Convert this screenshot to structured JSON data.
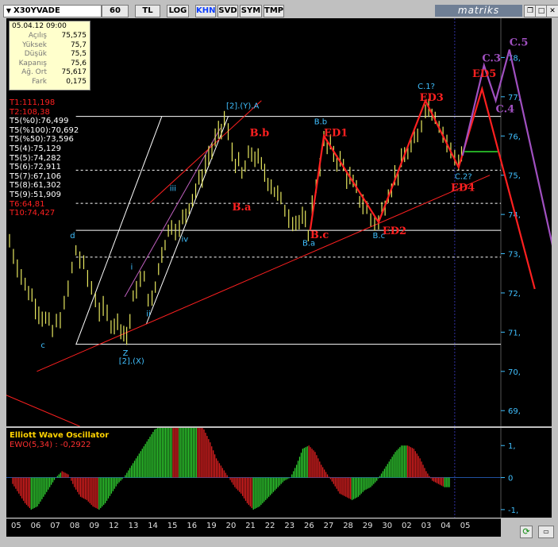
{
  "toolbar": {
    "symbol": "X30YVADE",
    "buttons": [
      {
        "label": "60",
        "active": false
      },
      {
        "label": "TL",
        "active": false
      },
      {
        "label": "LOG",
        "active": false
      },
      {
        "label": "KHN",
        "active": true
      },
      {
        "label": "SVD",
        "active": false
      },
      {
        "label": "SYM",
        "active": false
      },
      {
        "label": "TMP",
        "active": false
      }
    ],
    "brand": "matriks",
    "window_buttons": {
      "restore": "❐",
      "max": "□",
      "close": "✕"
    }
  },
  "info_box": {
    "datetime": "05.04.12 09:00",
    "rows": [
      {
        "label": "Açılış",
        "value": "75,575"
      },
      {
        "label": "Yüksek",
        "value": "75,7"
      },
      {
        "label": "Düşük",
        "value": "75,5"
      },
      {
        "label": "Kapanış",
        "value": "75,6"
      },
      {
        "label": "Ağ. Ort",
        "value": "75,617"
      },
      {
        "label": "Fark",
        "value": "0,175"
      }
    ]
  },
  "levels": [
    {
      "text": "T1:111,198",
      "color": "#ff2020"
    },
    {
      "text": "T2:108,38",
      "color": "#ff2020"
    },
    {
      "text": "T5(%0):76,499",
      "color": "#ffffff"
    },
    {
      "text": "T5(%100):70,692",
      "color": "#ffffff"
    },
    {
      "text": "T5(%50):73,596",
      "color": "#ffffff"
    },
    {
      "text": "T5(4):75,129",
      "color": "#ffffff"
    },
    {
      "text": "T5(5):74,282",
      "color": "#ffffff"
    },
    {
      "text": "T5(6):72,911",
      "color": "#ffffff"
    },
    {
      "text": "T5(7):67,106",
      "color": "#ffffff"
    },
    {
      "text": "T5(8):61,302",
      "color": "#ffffff"
    },
    {
      "text": "T5(9):51,909",
      "color": "#ffffff"
    },
    {
      "text": "T6:64,81",
      "color": "#ff2020"
    },
    {
      "text": "T10:74,427",
      "color": "#ff2020"
    }
  ],
  "chart_data": {
    "type": "line",
    "ylim": [
      68.6,
      79.0
    ],
    "y_ticks": [
      69,
      70,
      71,
      72,
      73,
      74,
      75,
      76,
      77,
      78
    ],
    "x_tick_labels": [
      "05",
      "06",
      "07",
      "08",
      "09",
      "12",
      "13",
      "14",
      "15",
      "16",
      "19",
      "20",
      "21",
      "22",
      "23",
      "26",
      "27",
      "28",
      "29",
      "30",
      "02",
      "03",
      "04",
      "05"
    ],
    "horizontal_levels": [
      76.499,
      70.692,
      73.596,
      75.129,
      74.282,
      72.911
    ],
    "price_path": [
      {
        "x": 0,
        "y": 73.3
      },
      {
        "x": 0.8,
        "y": 72.2
      },
      {
        "x": 1.5,
        "y": 71.6
      },
      {
        "x": 2.2,
        "y": 71.0
      },
      {
        "x": 2.8,
        "y": 71.6
      },
      {
        "x": 3.4,
        "y": 73.1
      },
      {
        "x": 4.0,
        "y": 72.4
      },
      {
        "x": 4.6,
        "y": 71.6
      },
      {
        "x": 5.2,
        "y": 71.3
      },
      {
        "x": 5.7,
        "y": 71.2
      },
      {
        "x": 6.0,
        "y": 70.9
      },
      {
        "x": 6.5,
        "y": 72.2
      },
      {
        "x": 6.9,
        "y": 72.3
      },
      {
        "x": 7.3,
        "y": 71.7
      },
      {
        "x": 7.8,
        "y": 73.1
      },
      {
        "x": 8.3,
        "y": 73.8
      },
      {
        "x": 8.7,
        "y": 73.6
      },
      {
        "x": 9.2,
        "y": 74.3
      },
      {
        "x": 9.7,
        "y": 74.8
      },
      {
        "x": 10.2,
        "y": 75.5
      },
      {
        "x": 10.7,
        "y": 76.0
      },
      {
        "x": 11.0,
        "y": 76.4
      },
      {
        "x": 11.4,
        "y": 75.6
      },
      {
        "x": 11.9,
        "y": 75.0
      },
      {
        "x": 12.4,
        "y": 75.6
      },
      {
        "x": 12.9,
        "y": 75.2
      },
      {
        "x": 13.4,
        "y": 74.8
      },
      {
        "x": 13.9,
        "y": 74.3
      },
      {
        "x": 14.5,
        "y": 73.9
      },
      {
        "x": 15.0,
        "y": 73.8
      },
      {
        "x": 15.3,
        "y": 73.6
      },
      {
        "x": 15.7,
        "y": 74.8
      },
      {
        "x": 16.1,
        "y": 75.8
      },
      {
        "x": 16.6,
        "y": 75.6
      },
      {
        "x": 17.1,
        "y": 75.2
      },
      {
        "x": 17.6,
        "y": 74.7
      },
      {
        "x": 18.1,
        "y": 74.3
      },
      {
        "x": 18.5,
        "y": 73.9
      },
      {
        "x": 18.9,
        "y": 73.8
      },
      {
        "x": 19.4,
        "y": 74.6
      },
      {
        "x": 19.9,
        "y": 75.1
      },
      {
        "x": 20.4,
        "y": 75.6
      },
      {
        "x": 20.9,
        "y": 75.9
      },
      {
        "x": 21.3,
        "y": 76.8
      },
      {
        "x": 21.8,
        "y": 76.6
      },
      {
        "x": 22.2,
        "y": 76.1
      },
      {
        "x": 22.6,
        "y": 75.6
      },
      {
        "x": 23.0,
        "y": 75.4
      },
      {
        "x": 23.3,
        "y": 75.6
      }
    ],
    "red_wave_path": [
      {
        "x": 15.4,
        "y": 73.6
      },
      {
        "x": 16.1,
        "y": 76.0
      },
      {
        "x": 18.9,
        "y": 73.8
      },
      {
        "x": 21.3,
        "y": 76.9
      },
      {
        "x": 23.0,
        "y": 75.2
      },
      {
        "x": 24.2,
        "y": 77.2
      },
      {
        "x": 26.9,
        "y": 72.1
      }
    ],
    "purple_wave_path": [
      {
        "x": 23.2,
        "y": 75.5
      },
      {
        "x": 24.3,
        "y": 77.8
      },
      {
        "x": 24.9,
        "y": 76.9
      },
      {
        "x": 25.6,
        "y": 78.2
      },
      {
        "x": 27.9,
        "y": 73.0
      }
    ],
    "wave_labels": [
      {
        "text": "[2].(Y).A",
        "x": 11.1,
        "y": 76.7,
        "color": "#40c0ff",
        "style": "small"
      },
      {
        "text": "[2].(X)",
        "x": 5.6,
        "y": 70.2,
        "color": "#40c0ff",
        "style": "small"
      },
      {
        "text": "Z",
        "x": 5.8,
        "y": 70.4,
        "color": "#40c0ff",
        "style": "small"
      },
      {
        "text": "c",
        "x": 1.6,
        "y": 70.6,
        "color": "#40c0ff",
        "style": "small"
      },
      {
        "text": "d",
        "x": 3.1,
        "y": 73.4,
        "color": "#40c0ff",
        "style": "small"
      },
      {
        "text": "i",
        "x": 6.2,
        "y": 72.6,
        "color": "#40c0ff",
        "style": "small"
      },
      {
        "text": "ii",
        "x": 7.0,
        "y": 71.4,
        "color": "#40c0ff",
        "style": "small"
      },
      {
        "text": "iii",
        "x": 8.2,
        "y": 74.6,
        "color": "#40c0ff",
        "style": "small"
      },
      {
        "text": "iv",
        "x": 8.8,
        "y": 73.3,
        "color": "#40c0ff",
        "style": "small"
      },
      {
        "text": "B.b",
        "x": 12.3,
        "y": 76.0,
        "color": "#ff2020",
        "style": "big"
      },
      {
        "text": "B.a",
        "x": 11.4,
        "y": 74.1,
        "color": "#ff2020",
        "style": "big"
      },
      {
        "text": "B.b",
        "x": 15.6,
        "y": 76.3,
        "color": "#40c0ff",
        "style": "small"
      },
      {
        "text": "B.a",
        "x": 15.0,
        "y": 73.2,
        "color": "#40c0ff",
        "style": "small"
      },
      {
        "text": "B.c",
        "x": 15.4,
        "y": 73.4,
        "color": "#ff2020",
        "style": "big"
      },
      {
        "text": "ED1",
        "x": 16.1,
        "y": 76.0,
        "color": "#ff2020",
        "style": "big"
      },
      {
        "text": "ED2",
        "x": 19.1,
        "y": 73.5,
        "color": "#ff2020",
        "style": "big"
      },
      {
        "text": "B.c",
        "x": 18.6,
        "y": 73.4,
        "color": "#40c0ff",
        "style": "small"
      },
      {
        "text": "ED3",
        "x": 21.0,
        "y": 76.9,
        "color": "#ff2020",
        "style": "big"
      },
      {
        "text": "C.1?",
        "x": 20.9,
        "y": 77.2,
        "color": "#40c0ff",
        "style": "small"
      },
      {
        "text": "C.2?",
        "x": 22.8,
        "y": 74.9,
        "color": "#40c0ff",
        "style": "small"
      },
      {
        "text": "ED4",
        "x": 22.6,
        "y": 74.6,
        "color": "#ff2020",
        "style": "big"
      },
      {
        "text": "ED5",
        "x": 23.7,
        "y": 77.5,
        "color": "#ff2020",
        "style": "big"
      },
      {
        "text": "C.3",
        "x": 24.2,
        "y": 77.9,
        "color": "#a050c0",
        "style": "big"
      },
      {
        "text": "C.4",
        "x": 24.9,
        "y": 76.6,
        "color": "#a050c0",
        "style": "big"
      },
      {
        "text": "C.5",
        "x": 25.6,
        "y": 78.3,
        "color": "#a050c0",
        "style": "big"
      }
    ],
    "oscillator": {
      "title": "Elliott Wave Oscillator",
      "value_label": "EWO(5,34)",
      "value": "-0,2922",
      "ylim": [
        -1.25,
        1.55
      ],
      "y_ticks": [
        1,
        0,
        -1
      ],
      "y_tick_labels": [
        "1,",
        "0",
        "-1,"
      ],
      "values": [
        -0.2,
        -0.5,
        -0.8,
        -1.0,
        -0.9,
        -0.6,
        -0.3,
        0.0,
        0.2,
        0.1,
        -0.3,
        -0.6,
        -0.7,
        -0.9,
        -1.0,
        -0.8,
        -0.5,
        -0.2,
        0.0,
        0.3,
        0.6,
        0.9,
        1.2,
        1.5,
        1.6,
        1.7,
        1.7,
        1.6,
        1.6,
        1.7,
        1.7,
        1.5,
        1.1,
        0.6,
        0.3,
        0.0,
        -0.3,
        -0.5,
        -0.8,
        -1.0,
        -0.9,
        -0.7,
        -0.5,
        -0.3,
        -0.1,
        0.0,
        0.4,
        0.9,
        1.0,
        0.8,
        0.4,
        0.1,
        -0.2,
        -0.5,
        -0.6,
        -0.7,
        -0.6,
        -0.4,
        -0.3,
        -0.1,
        0.2,
        0.5,
        0.8,
        1.0,
        1.0,
        0.9,
        0.6,
        0.2,
        -0.1,
        -0.2,
        -0.3,
        -0.3
      ]
    }
  }
}
